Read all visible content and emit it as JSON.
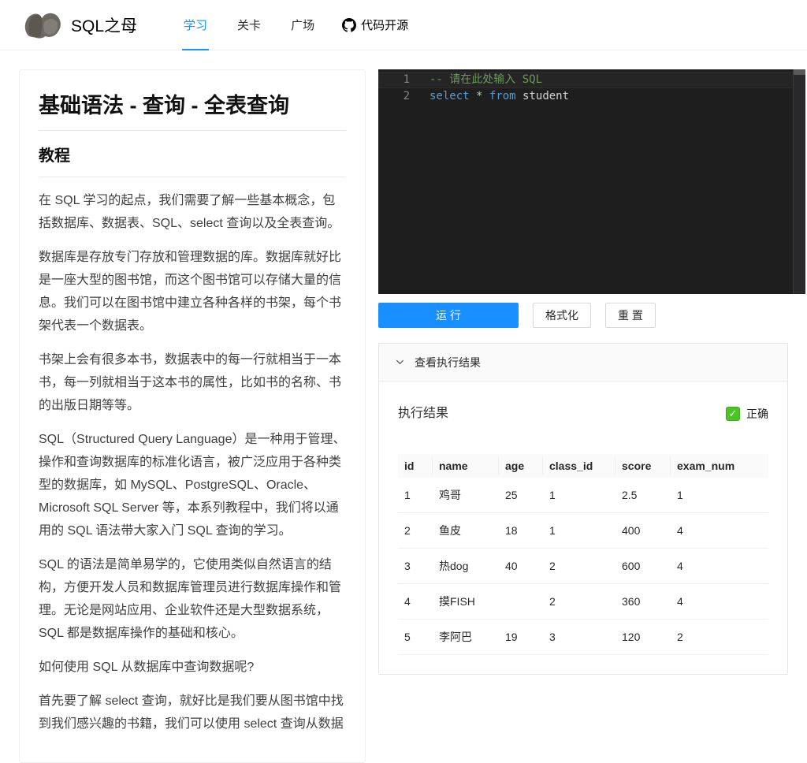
{
  "navbar": {
    "brand": "SQL之母",
    "items": [
      {
        "label": "学习",
        "active": true
      },
      {
        "label": "关卡",
        "active": false
      },
      {
        "label": "广场",
        "active": false
      }
    ],
    "github_label": "代码开源"
  },
  "tutorial": {
    "title": "基础语法 - 查询 - 全表查询",
    "section_heading": "教程",
    "paragraphs": [
      "在 SQL 学习的起点，我们需要了解一些基本概念，包括数据库、数据表、SQL、select 查询以及全表查询。",
      "数据库是存放专门存放和管理数据的库。数据库就好比是一座大型的图书馆，而这个图书馆可以存储大量的信息。我们可以在图书馆中建立各种各样的书架，每个书架代表一个数据表。",
      "书架上会有很多本书，数据表中的每一行就相当于一本书，每一列就相当于这本书的属性，比如书的名称、书的出版日期等等。",
      "SQL（Structured Query Language）是一种用于管理、操作和查询数据库的标准化语言，被广泛应用于各种类型的数据库，如 MySQL、PostgreSQL、Oracle、Microsoft SQL Server 等，本系列教程中，我们将以通用的 SQL 语法带大家入门 SQL 查询的学习。",
      "SQL 的语法是简单易学的，它使用类似自然语言的结构，方便开发人员和数据库管理员进行数据库操作和管理。无论是网站应用、企业软件还是大型数据系统，SQL 都是数据库操作的基础和核心。",
      "如何使用 SQL 从数据库中查询数据呢?",
      "首先要了解 select 查询，就好比是我们要从图书馆中找到我们感兴趣的书籍，我们可以使用 select 查询从数据"
    ]
  },
  "editor": {
    "lines": [
      {
        "number": "1",
        "current": true,
        "tokens": [
          {
            "type": "comment",
            "text": "-- 请在此处输入 SQL"
          }
        ]
      },
      {
        "number": "2",
        "current": false,
        "tokens": [
          {
            "type": "keyword",
            "text": "select"
          },
          {
            "type": "plain",
            "text": " "
          },
          {
            "type": "operator",
            "text": "*"
          },
          {
            "type": "plain",
            "text": " "
          },
          {
            "type": "keyword",
            "text": "from"
          },
          {
            "type": "plain",
            "text": " student"
          }
        ]
      }
    ]
  },
  "toolbar": {
    "run_label": "运 行",
    "format_label": "格式化",
    "reset_label": "重 置"
  },
  "results": {
    "collapse_label": "查看执行结果",
    "heading": "执行结果",
    "status_check": "✓",
    "status_text": "正确",
    "table": {
      "columns": [
        "id",
        "name",
        "age",
        "class_id",
        "score",
        "exam_num"
      ],
      "rows": [
        [
          "1",
          "鸡哥",
          "25",
          "1",
          "2.5",
          "1"
        ],
        [
          "2",
          "鱼皮",
          "18",
          "1",
          "400",
          "4"
        ],
        [
          "3",
          "热dog",
          "40",
          "2",
          "600",
          "4"
        ],
        [
          "4",
          "摸FISH",
          "",
          "2",
          "360",
          "4"
        ],
        [
          "5",
          "李阿巴",
          "19",
          "3",
          "120",
          "2"
        ]
      ]
    }
  },
  "colors": {
    "accent_blue": "#1890ff",
    "success_green": "#4cc425",
    "editor_background": "#1e1e1e",
    "editor_comment": "#6a9955",
    "editor_keyword": "#569cd6",
    "editor_operator": "#b5cea8"
  }
}
